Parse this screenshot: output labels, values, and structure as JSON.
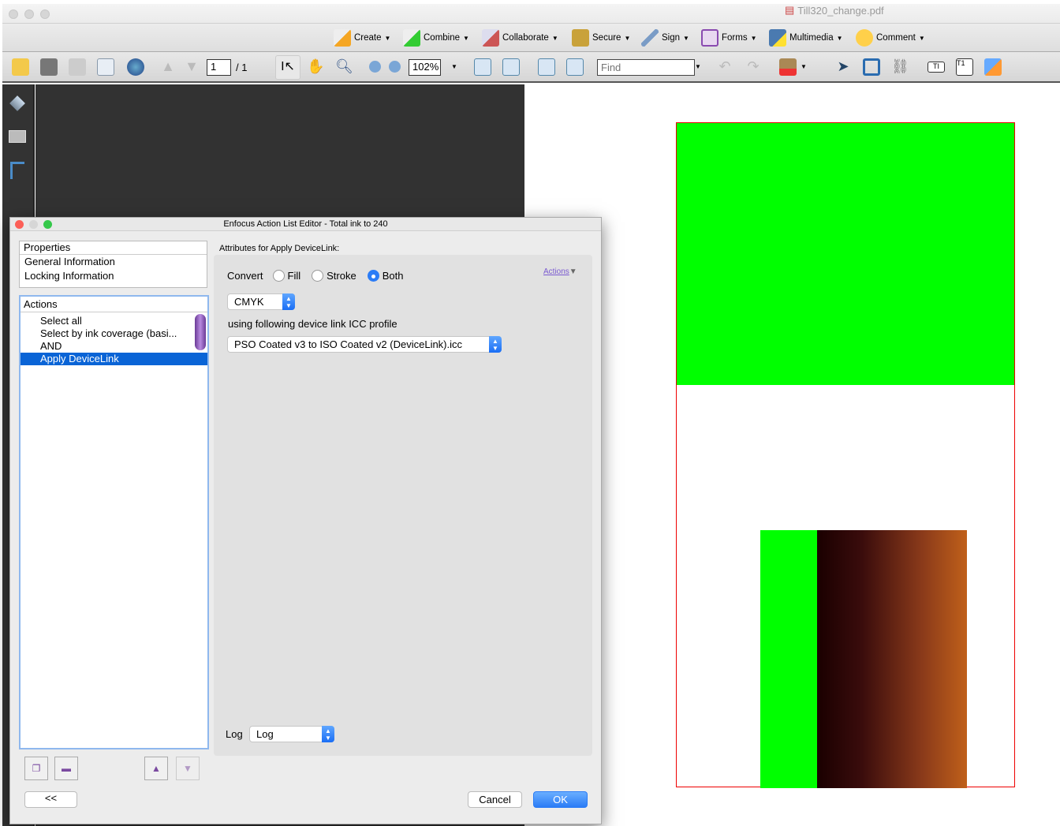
{
  "window": {
    "title": "Till320_change.pdf"
  },
  "toolbar_tasks": [
    {
      "label": "Create"
    },
    {
      "label": "Combine"
    },
    {
      "label": "Collaborate"
    },
    {
      "label": "Secure"
    },
    {
      "label": "Sign"
    },
    {
      "label": "Forms"
    },
    {
      "label": "Multimedia"
    },
    {
      "label": "Comment"
    }
  ],
  "toolbar": {
    "page_current": "1",
    "page_total": "/ 1",
    "zoom": "102%",
    "find_placeholder": "Find"
  },
  "dialog": {
    "title": "Enfocus Action List Editor - Total ink to 240",
    "properties": {
      "header": "Properties",
      "items": [
        "General Information",
        "Locking Information"
      ]
    },
    "actions": {
      "header": "Actions",
      "items": [
        "Select all",
        "Select by ink coverage (basi...",
        "AND",
        "Apply DeviceLink"
      ],
      "selected_index": 3
    },
    "attributes_title": "Attributes for Apply DeviceLink:",
    "convert_label": "Convert",
    "convert_options": [
      "Fill",
      "Stroke",
      "Both"
    ],
    "convert_selected": "Both",
    "actions_link": "Actions",
    "colorspace": "CMYK",
    "profile_label": "using following device link ICC profile",
    "profile": "PSO Coated v3 to ISO Coated v2 (DeviceLink).icc",
    "log_label": "Log",
    "log_value": "Log",
    "back_button": "<<",
    "cancel_button": "Cancel",
    "ok_button": "OK"
  },
  "colors": {
    "selection": "#0a64d6",
    "ok": "#2b7cf6",
    "green": "#00ff00"
  }
}
